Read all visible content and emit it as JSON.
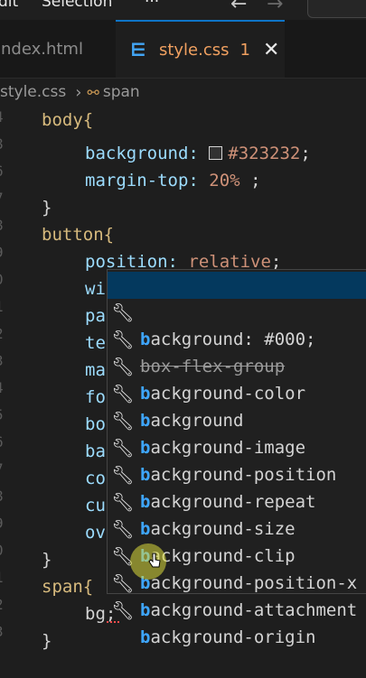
{
  "menubar": {
    "items": [
      "dit",
      "Selection",
      "···"
    ],
    "back_icon": "arrow-left-icon",
    "forward_icon": "arrow-right-icon"
  },
  "tabs": [
    {
      "label": "index.html",
      "active": false
    },
    {
      "label": "style.css",
      "active": true,
      "badge": "1",
      "close_icon": "close-icon"
    }
  ],
  "breadcrumb": {
    "file": "style.css",
    "symbol": "span"
  },
  "gutter": [
    "4",
    "8",
    "6",
    "7",
    "8",
    "9",
    "0",
    "1",
    "2",
    "3",
    "4",
    "5",
    "6",
    "7",
    "8",
    "9",
    "0",
    "1",
    "2",
    "3"
  ],
  "code": {
    "l1": "body{",
    "l2_prop": "background:",
    "l2_val": "#323232",
    "l3_prop": "margin-top:",
    "l3_val": "20%",
    "l4": "}",
    "l5": "button{",
    "l6_prop": "position:",
    "l6_val": "relative",
    "partials": [
      "wi",
      "pa",
      "te",
      "ma",
      "fo",
      "bo",
      "ba",
      "co",
      "cu",
      "ov"
    ],
    "l17": "}",
    "l18": "span{",
    "l19": "bg;",
    "l20": "}"
  },
  "suggestions": [
    {
      "match": "b",
      "rest": "ackground: #000;",
      "selected": true
    },
    {
      "match": "",
      "rest": "box-flex-group",
      "deprecated": true
    },
    {
      "match": "b",
      "rest": "ackground-color"
    },
    {
      "match": "b",
      "rest": "ackground"
    },
    {
      "match": "b",
      "rest": "ackground-image"
    },
    {
      "match": "b",
      "rest": "ackground-position"
    },
    {
      "match": "b",
      "rest": "ackground-repeat"
    },
    {
      "match": "b",
      "rest": "ackground-size"
    },
    {
      "match": "b",
      "rest": "ackground-clip"
    },
    {
      "match": "b",
      "rest": "ackground-position-x"
    },
    {
      "match": "b",
      "rest": "ackground-attachment"
    },
    {
      "match": "b",
      "rest": "ackground-origin"
    }
  ],
  "colors": {
    "accent": "#0e74c7",
    "match": "#3ea6ff",
    "modified": "#f0a060",
    "brace": "#ffd700"
  }
}
